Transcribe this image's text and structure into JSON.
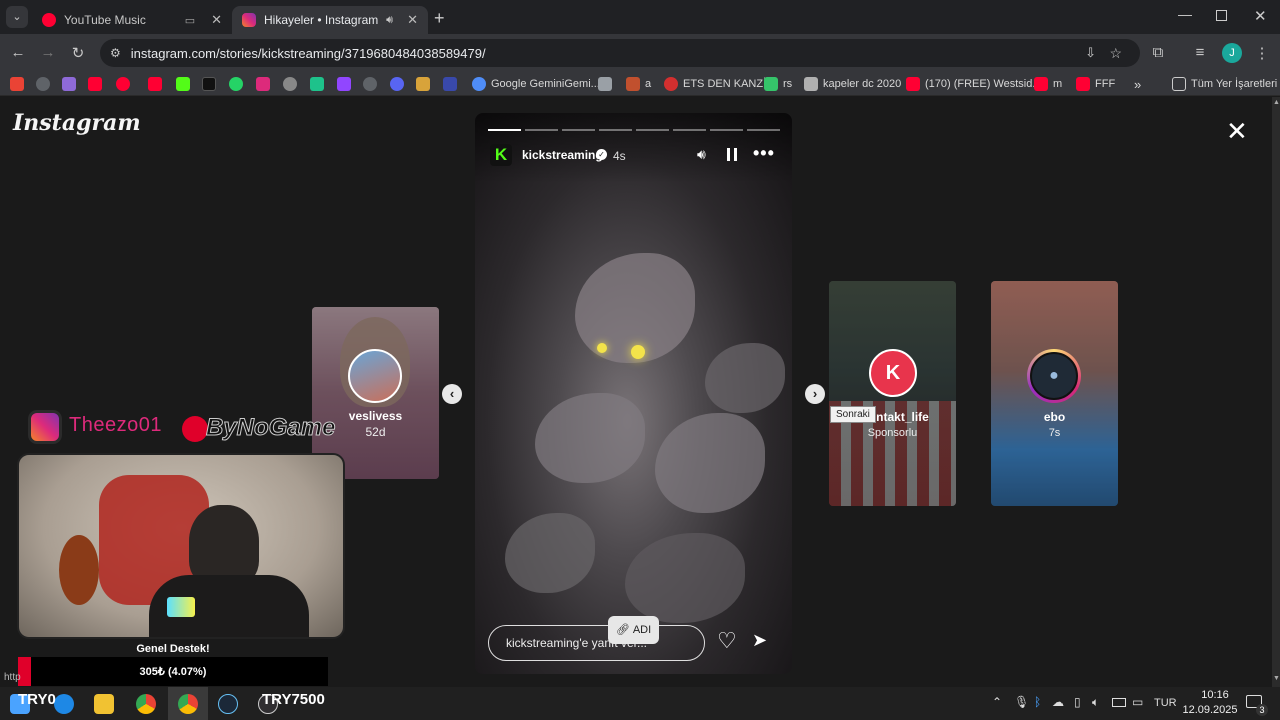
{
  "browser": {
    "tabs": [
      {
        "title": "YouTube Music",
        "active": false
      },
      {
        "title": "Hikayeler • Instagram",
        "active": true
      }
    ],
    "url": "instagram.com/stories/kickstreaming/3719680484038589479/",
    "bookmarks": [
      {
        "label": "Google GeminiGemi..."
      },
      {
        "label": "a"
      },
      {
        "label": "ETS DEN KANZİ"
      },
      {
        "label": "rs"
      },
      {
        "label": "kapeler dc 2020"
      },
      {
        "label": "(170) (FREE) Westsid..."
      },
      {
        "label": "m"
      },
      {
        "label": "FFF"
      },
      {
        "label": "Tüm Yer İşaretleri"
      }
    ],
    "bookmark_more": "»",
    "profile_initial": "J"
  },
  "instagram": {
    "logo": "Instagram",
    "close_glyph": "✕",
    "story": {
      "username": "kickstreaming",
      "time": "4s",
      "reply_placeholder": "kickstreaming'e yanıt ver...",
      "progress_segments": 8,
      "progress_active": 1
    },
    "prev_story": {
      "username": "veslivess",
      "time": "52d"
    },
    "next_stories": [
      {
        "username": "ntakt_life",
        "subtitle": "Sponsorlu"
      },
      {
        "username": "ebo",
        "subtitle": "7s"
      }
    ],
    "tooltip": "Sonraki"
  },
  "overlay": {
    "instagram_handle": "Theezo01",
    "brand": "ByNoGame",
    "chip_label": "ADI",
    "donation_title": "Genel Destek!",
    "donation_progress": "305₺ (4.07%)",
    "donation_fraction": 0.0407,
    "currency_left": "TRY0",
    "currency_right": "TRY7500",
    "url_hint": "http"
  },
  "taskbar": {
    "language": "TUR",
    "time": "10:16",
    "date": "12.09.2025",
    "notifications": "3"
  },
  "colors": {
    "accent_red": "#e0002a",
    "instagram_pink": "#dd2a7b",
    "kick_green": "#53fc18"
  }
}
